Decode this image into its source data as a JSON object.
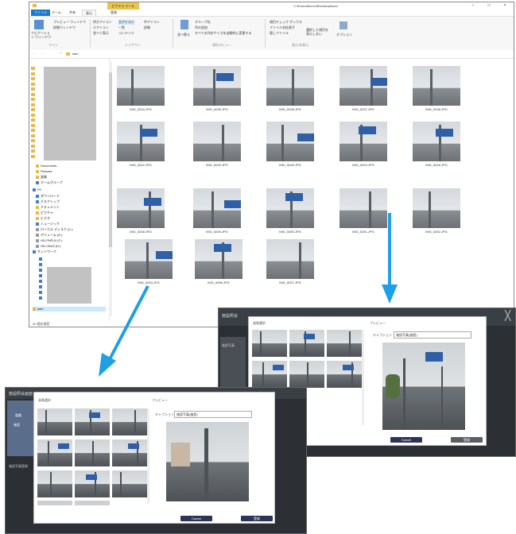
{
  "explorer": {
    "tool_tab": "ピクチャ ツール",
    "path_title": "C:¥Users¥konor¥Desktop¥sam",
    "tabs": [
      "ファイル",
      "ホーム",
      "共有",
      "表示",
      "管理"
    ],
    "ribbon": {
      "pane": [
        "ナビゲーション ウィンドウ",
        "プレビュー ウィンドウ",
        "詳細ウィンドウ"
      ],
      "layout": [
        "特大アイコン",
        "大アイコン",
        "中アイコン",
        "小アイコン",
        "一覧",
        "詳細",
        "並べて表示",
        "コンテンツ"
      ],
      "sort_label": "並べ替え",
      "current_view": [
        "グループ化",
        "列の追加",
        "すべての列のサイズを自動的に変更する"
      ],
      "show_hide": [
        "項目チェック ボックス",
        "ファイル名拡張子",
        "隠しファイル"
      ],
      "hide_selected": "選択した項目を表示しない",
      "options": "オプション",
      "groups": [
        "ペイン",
        "レイアウト",
        "現在のビュー",
        "表示/非表示"
      ]
    },
    "address": "sam",
    "nav": [
      "Documents",
      "Pictures",
      "画像",
      "ホームグループ",
      "PC",
      "ダウンロード",
      "デスクトップ",
      "ドキュメント",
      "ピクチャ",
      "ビデオ",
      "ミュージック",
      "ローカル ディスク (C:)",
      "ボリューム (E:)",
      "HD-PNFU3 (F:)",
      "HD-CBU2 (H:)",
      "ネットワーク",
      "sam"
    ],
    "status": "20 個の項目",
    "files": [
      "IMG_5234.JPG",
      "IMG_5235.JPG",
      "IMG_5236.JPG",
      "IMG_5237.JPG",
      "IMG_5238.JPG",
      "IMG_5242.JPG",
      "IMG_5243.JPG",
      "IMG_5245.JPG",
      "IMG_5244.JPG",
      "IMG_5245.JPG",
      "IMG_5248.JPG",
      "IMG_5249.JPG",
      "IMG_5250.JPG",
      "IMG_5251.JPG",
      "IMG_5252.JPG",
      "IMG_5253.JPG",
      "IMG_5256.JPG",
      "IMG_5257.JPG"
    ]
  },
  "dialog_right": {
    "app_title": "施設照会",
    "side_label": "施設写真",
    "section_images": "画像選択",
    "section_preview": "プレビュー",
    "caption_label": "キャプション",
    "caption_value": "施設写真(施設)",
    "cancel": "Cancel",
    "ok": "登録"
  },
  "dialog_left": {
    "app_title": "施設照会画面",
    "side_a": "道路",
    "side_b": "施設",
    "side_label": "施設写真登録",
    "section_images": "画像選択",
    "section_preview": "プレビュー",
    "caption_label": "キャプション",
    "caption_value": "施設写真(施設)",
    "cancel": "Cancel",
    "ok": "登録"
  },
  "colors": {
    "accent": "#1ea0e6",
    "file_tab": "#1979ca",
    "tool_tab": "#e8c44a",
    "folder": "#e9b949",
    "dialog_button": "#2c3557"
  },
  "icons": [
    "folder-icon",
    "arrow-down-icon",
    "arrow-down-left-icon",
    "close-icon"
  ]
}
